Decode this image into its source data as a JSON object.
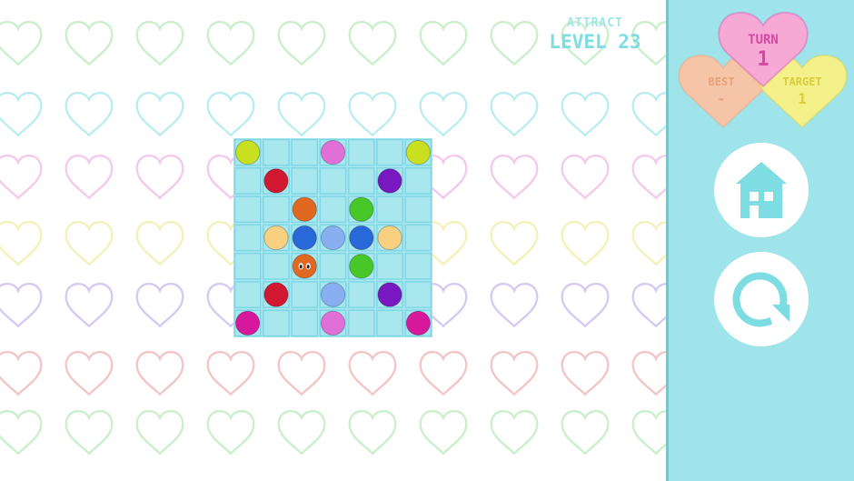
{
  "header": {
    "mode": "ATTRACT",
    "level": "LEVEL 23"
  },
  "stats": {
    "turn_label": "TURN",
    "turn_value": "1",
    "best_label": "BEST",
    "best_value": "-",
    "target_label": "TARGET",
    "target_value": "1"
  },
  "buttons": {
    "home": "home-icon",
    "restart": "restart-icon"
  },
  "colors": {
    "sidebar_bg": "#9ee4ea",
    "sidebar_border": "#5fcfd8",
    "title_mode": "#9fe6ea",
    "title_level": "#7ddde2",
    "board_bg": "#a9e7ef",
    "board_line": "#7fd6e4",
    "icon_color": "#7ddde2",
    "heart_turn": "#f7a9d6",
    "heart_best": "#f6c4a6",
    "heart_target": "#f4f08a",
    "heart_turn_text": "#d44aa3",
    "heart_best_text": "#e8a27c",
    "heart_target_text": "#d6cf3c",
    "bg_heart_rows": [
      "#c8f0c8",
      "#b8ecf0",
      "#f4c8ec",
      "#f4f0b8",
      "#d4c8f4",
      "#f4c4c4",
      "#c8f0c8"
    ]
  },
  "board": {
    "size": 7,
    "pieces": [
      {
        "row": 0,
        "col": 0,
        "color": "#c8e020",
        "name": "yellow-green"
      },
      {
        "row": 0,
        "col": 3,
        "color": "#e070d8",
        "name": "violet"
      },
      {
        "row": 0,
        "col": 6,
        "color": "#c8e020",
        "name": "yellow-green"
      },
      {
        "row": 1,
        "col": 1,
        "color": "#d01830",
        "name": "red"
      },
      {
        "row": 1,
        "col": 5,
        "color": "#7818c0",
        "name": "purple"
      },
      {
        "row": 2,
        "col": 2,
        "color": "#e06820",
        "name": "orange"
      },
      {
        "row": 2,
        "col": 4,
        "color": "#48c828",
        "name": "green"
      },
      {
        "row": 3,
        "col": 1,
        "color": "#f8d080",
        "name": "cream"
      },
      {
        "row": 3,
        "col": 2,
        "color": "#2868d8",
        "name": "blue"
      },
      {
        "row": 3,
        "col": 3,
        "color": "#88b0f0",
        "name": "light-blue"
      },
      {
        "row": 3,
        "col": 4,
        "color": "#2868d8",
        "name": "blue"
      },
      {
        "row": 3,
        "col": 5,
        "color": "#f8d080",
        "name": "cream"
      },
      {
        "row": 4,
        "col": 2,
        "color": "#e06820",
        "name": "orange-face"
      },
      {
        "row": 4,
        "col": 4,
        "color": "#48c828",
        "name": "green"
      },
      {
        "row": 5,
        "col": 1,
        "color": "#d01830",
        "name": "red"
      },
      {
        "row": 5,
        "col": 3,
        "color": "#88b0f0",
        "name": "light-blue"
      },
      {
        "row": 5,
        "col": 5,
        "color": "#7818c0",
        "name": "purple"
      },
      {
        "row": 6,
        "col": 0,
        "color": "#d8189c",
        "name": "magenta"
      },
      {
        "row": 6,
        "col": 3,
        "color": "#e070d8",
        "name": "violet"
      },
      {
        "row": 6,
        "col": 6,
        "color": "#d8189c",
        "name": "magenta"
      }
    ]
  }
}
